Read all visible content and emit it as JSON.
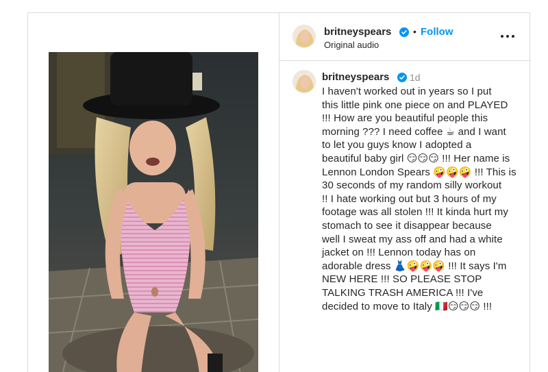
{
  "post": {
    "username": "britneyspears",
    "follow_label": "Follow",
    "separator": "•",
    "audio_label": "Original audio",
    "more_icon": "more-options-icon",
    "verified_color": "#0095f6",
    "link_color": "#0095f6"
  },
  "comment": {
    "username": "britneyspears",
    "time": "1d",
    "caption": "I haven't worked out in years so I put\nthis little pink one piece on and PLAYED\n!!! How are you beautiful people this\nmorning ??? I need coffee ☕ and I want\nto let you guys know I adopted a\nbeautiful baby girl 😏😏😏 !!! Her name is\nLennon London Spears 🤪🤪🤪 !!! This is\n30 seconds of my random silly workout\n!! I hate working out but 3 hours of my\nfootage was all stolen !!! It kinda hurt my\nstomach to see it disappear because\nwell I sweat my ass off and had a white\njacket on !!!  Lennon today has on\nadorable dress 👗🤪🤪🤪 !!! It says I'm\nNEW HERE !!! SO PLEASE STOP\nTALKING TRASH AMERICA !!! I've\ndecided to move to Italy 🇮🇹😏😏😏 !!!"
  }
}
